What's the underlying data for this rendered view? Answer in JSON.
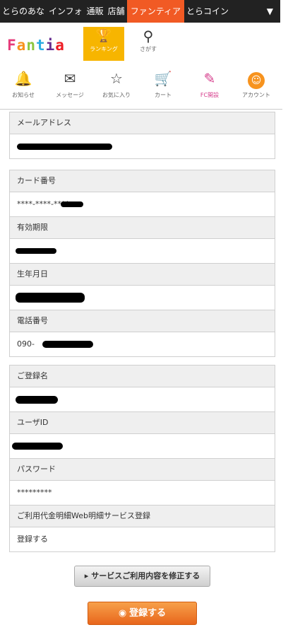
{
  "topnav": {
    "items": [
      "とらのあな",
      "インフォ",
      "通販",
      "店舗",
      "ファンティア",
      "とらコイン"
    ],
    "active_index": 4,
    "menu_arrow": "▼"
  },
  "brand": {
    "logo_text": [
      "F",
      "a",
      "n",
      "t",
      "i",
      "a"
    ],
    "ranking_label": "ランキング",
    "search_label": "さがす"
  },
  "iconbar": {
    "items": [
      {
        "icon": "bell-icon",
        "glyph": "🔔",
        "label": "お知らせ"
      },
      {
        "icon": "mail-icon",
        "glyph": "✉",
        "label": "メッセージ"
      },
      {
        "icon": "star-icon",
        "glyph": "☆",
        "label": "お気に入り"
      },
      {
        "icon": "cart-icon",
        "glyph": "🛒",
        "label": "カート"
      },
      {
        "icon": "pencil-icon",
        "glyph": "✎",
        "label": "FC開設"
      },
      {
        "icon": "account-icon",
        "glyph": "☺",
        "label": "アカウント"
      }
    ]
  },
  "form": {
    "email_label": "メールアドレス",
    "card_number_label": "カード番号",
    "card_number_value": "****-****-****-",
    "expiry_label": "有効期限",
    "expiry_value": "",
    "birthdate_label": "生年月日",
    "phone_label": "電話番号",
    "phone_value": "090-",
    "name_label": "ご登録名",
    "userid_label": "ユーザID",
    "password_label": "パスワード",
    "password_value": "*********",
    "webstatement_label": "ご利用代金明細Web明細サービス登録",
    "webstatement_value": "登録する"
  },
  "buttons": {
    "edit_label": "サービスご利用内容を修正する",
    "register_label": "登録する"
  },
  "colors": {
    "accent_orange": "#f15a24",
    "ranking_yellow": "#f7b500",
    "register_orange": "#e8661c"
  }
}
